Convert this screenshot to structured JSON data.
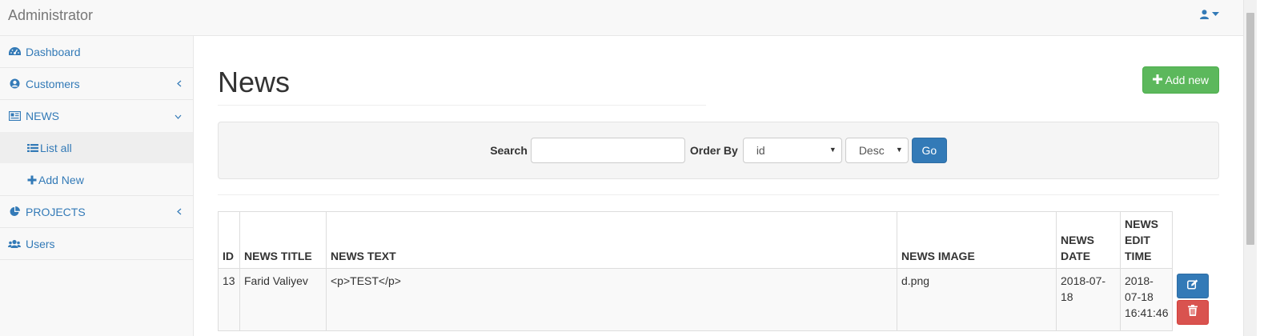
{
  "navbar": {
    "brand": "Administrator",
    "user_icon": "user-icon"
  },
  "sidebar": {
    "items": [
      {
        "label": "Dashboard",
        "icon": "dashboard-icon"
      },
      {
        "label": "Customers",
        "icon": "user-circle-icon"
      },
      {
        "label": "NEWS",
        "icon": "newspaper-icon"
      },
      {
        "label": "PROJECTS",
        "icon": "pie-chart-icon"
      },
      {
        "label": "Users",
        "icon": "users-icon"
      }
    ],
    "news_sub": [
      {
        "label": "List all",
        "icon": "list-icon"
      },
      {
        "label": "Add New",
        "icon": "plus-icon"
      }
    ]
  },
  "main": {
    "title": "News",
    "add_button": "Add new",
    "search_label": "Search",
    "search_value": "",
    "order_label": "Order By",
    "order_field": "id",
    "order_dir": "Desc",
    "go_button": "Go"
  },
  "table": {
    "headers": {
      "id": "ID",
      "title": "NEWS TITLE",
      "text": "NEWS TEXT",
      "image": "NEWS IMAGE",
      "date": "NEWS DATE",
      "edit": "NEWS EDIT TIME"
    },
    "rows": [
      {
        "id": "13",
        "title": "Farid Valiyev",
        "text": "<p>TEST</p>",
        "image": "d.png",
        "date": "2018-07-18",
        "edit": "2018-07-18 16:41:46"
      }
    ]
  },
  "colors": {
    "primary": "#337ab7",
    "success": "#5cb85c",
    "danger": "#d9534f"
  }
}
